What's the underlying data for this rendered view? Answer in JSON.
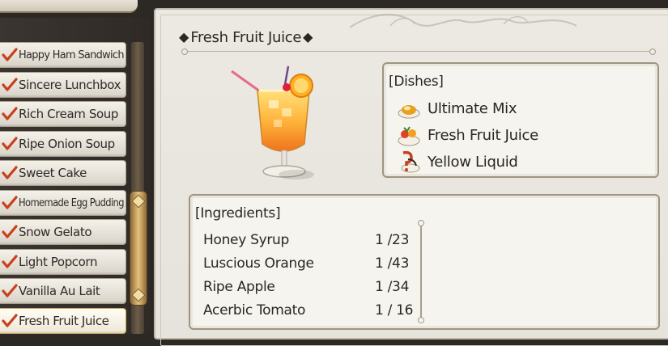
{
  "recipe_list": {
    "items": [
      {
        "label": "Happy Ham Sandwich",
        "checked": true,
        "narrow": true
      },
      {
        "label": "Sincere Lunchbox",
        "checked": true
      },
      {
        "label": "Rich Cream Soup",
        "checked": true
      },
      {
        "label": "Ripe Onion Soup",
        "checked": true
      },
      {
        "label": "Sweet Cake",
        "checked": true
      },
      {
        "label": "Homemade Egg Pudding",
        "checked": true,
        "narrow": true
      },
      {
        "label": "Snow Gelato",
        "checked": true
      },
      {
        "label": "Light Popcorn",
        "checked": true
      },
      {
        "label": "Vanilla Au Lait",
        "checked": true
      },
      {
        "label": "Fresh Fruit Juice",
        "checked": true,
        "selected": true
      }
    ]
  },
  "detail": {
    "title": "Fresh Fruit Juice",
    "title_prefix": "◆",
    "title_suffix": "◆",
    "dishes_heading": "[Dishes]",
    "dishes": [
      {
        "label": "Ultimate Mix",
        "icon": "golden-dish-icon"
      },
      {
        "label": "Fresh Fruit Juice",
        "icon": "fruit-plate-icon"
      },
      {
        "label": "Yellow Liquid",
        "icon": "failed-dish-icon"
      }
    ],
    "ingredients_heading": "[Ingredients]",
    "ingredients": [
      {
        "name": "Honey Syrup",
        "count": "1 /23"
      },
      {
        "name": "Luscious Orange",
        "count": "1 /43"
      },
      {
        "name": "Ripe Apple",
        "count": "1 /34"
      },
      {
        "name": "Acerbic Tomato",
        "count": "1 / 16"
      }
    ]
  },
  "colors": {
    "check": "#c8401e",
    "text": "#2a2622",
    "parchment": "#ece9e3",
    "accent_gold": "#e6c27a"
  }
}
